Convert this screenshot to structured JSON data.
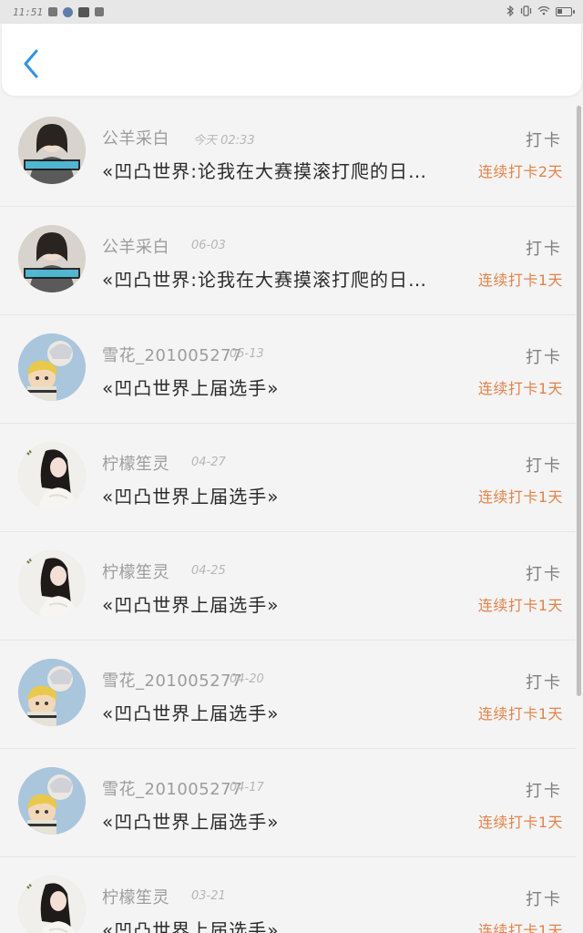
{
  "status_bar": {
    "time": "11:51",
    "left_icons": [
      "app-icon",
      "notification-icon",
      "app-icon",
      "message-icon"
    ],
    "right_icons": [
      "bluetooth-icon",
      "vibrate-icon",
      "wifi-icon",
      "battery-icon"
    ]
  },
  "header": {
    "back_icon": "chevron-left-icon"
  },
  "list": {
    "items": [
      {
        "name": "公羊采白",
        "date": "今天 02:33",
        "title": "«凹凸世界:论我在大赛摸滚打爬的日…",
        "action": "打卡",
        "streak": "连续打卡2天",
        "avatar": "avatar-a"
      },
      {
        "name": "公羊采白",
        "date": "06-03",
        "title": "«凹凸世界:论我在大赛摸滚打爬的日…",
        "action": "打卡",
        "streak": "连续打卡1天",
        "avatar": "avatar-a"
      },
      {
        "name": "雪花_201005277",
        "date": "05-13",
        "title": "«凹凸世界上届选手»",
        "action": "打卡",
        "streak": "连续打卡1天",
        "avatar": "avatar-b"
      },
      {
        "name": "柠檬笙灵",
        "date": "04-27",
        "title": "«凹凸世界上届选手»",
        "action": "打卡",
        "streak": "连续打卡1天",
        "avatar": "avatar-c"
      },
      {
        "name": "柠檬笙灵",
        "date": "04-25",
        "title": "«凹凸世界上届选手»",
        "action": "打卡",
        "streak": "连续打卡1天",
        "avatar": "avatar-c"
      },
      {
        "name": "雪花_201005277",
        "date": "04-20",
        "title": "«凹凸世界上届选手»",
        "action": "打卡",
        "streak": "连续打卡1天",
        "avatar": "avatar-b"
      },
      {
        "name": "雪花_201005277",
        "date": "04-17",
        "title": "«凹凸世界上届选手»",
        "action": "打卡",
        "streak": "连续打卡1天",
        "avatar": "avatar-b"
      },
      {
        "name": "柠檬笙灵",
        "date": "03-21",
        "title": "«凹凸世界上届选手»",
        "action": "打卡",
        "streak": "连续打卡1天",
        "avatar": "avatar-c"
      }
    ]
  },
  "colors": {
    "accent_blue": "#2f93e3",
    "streak_orange": "#e2834a",
    "name_gray": "#9c9c9c",
    "title_dark": "#2b2b2b"
  }
}
